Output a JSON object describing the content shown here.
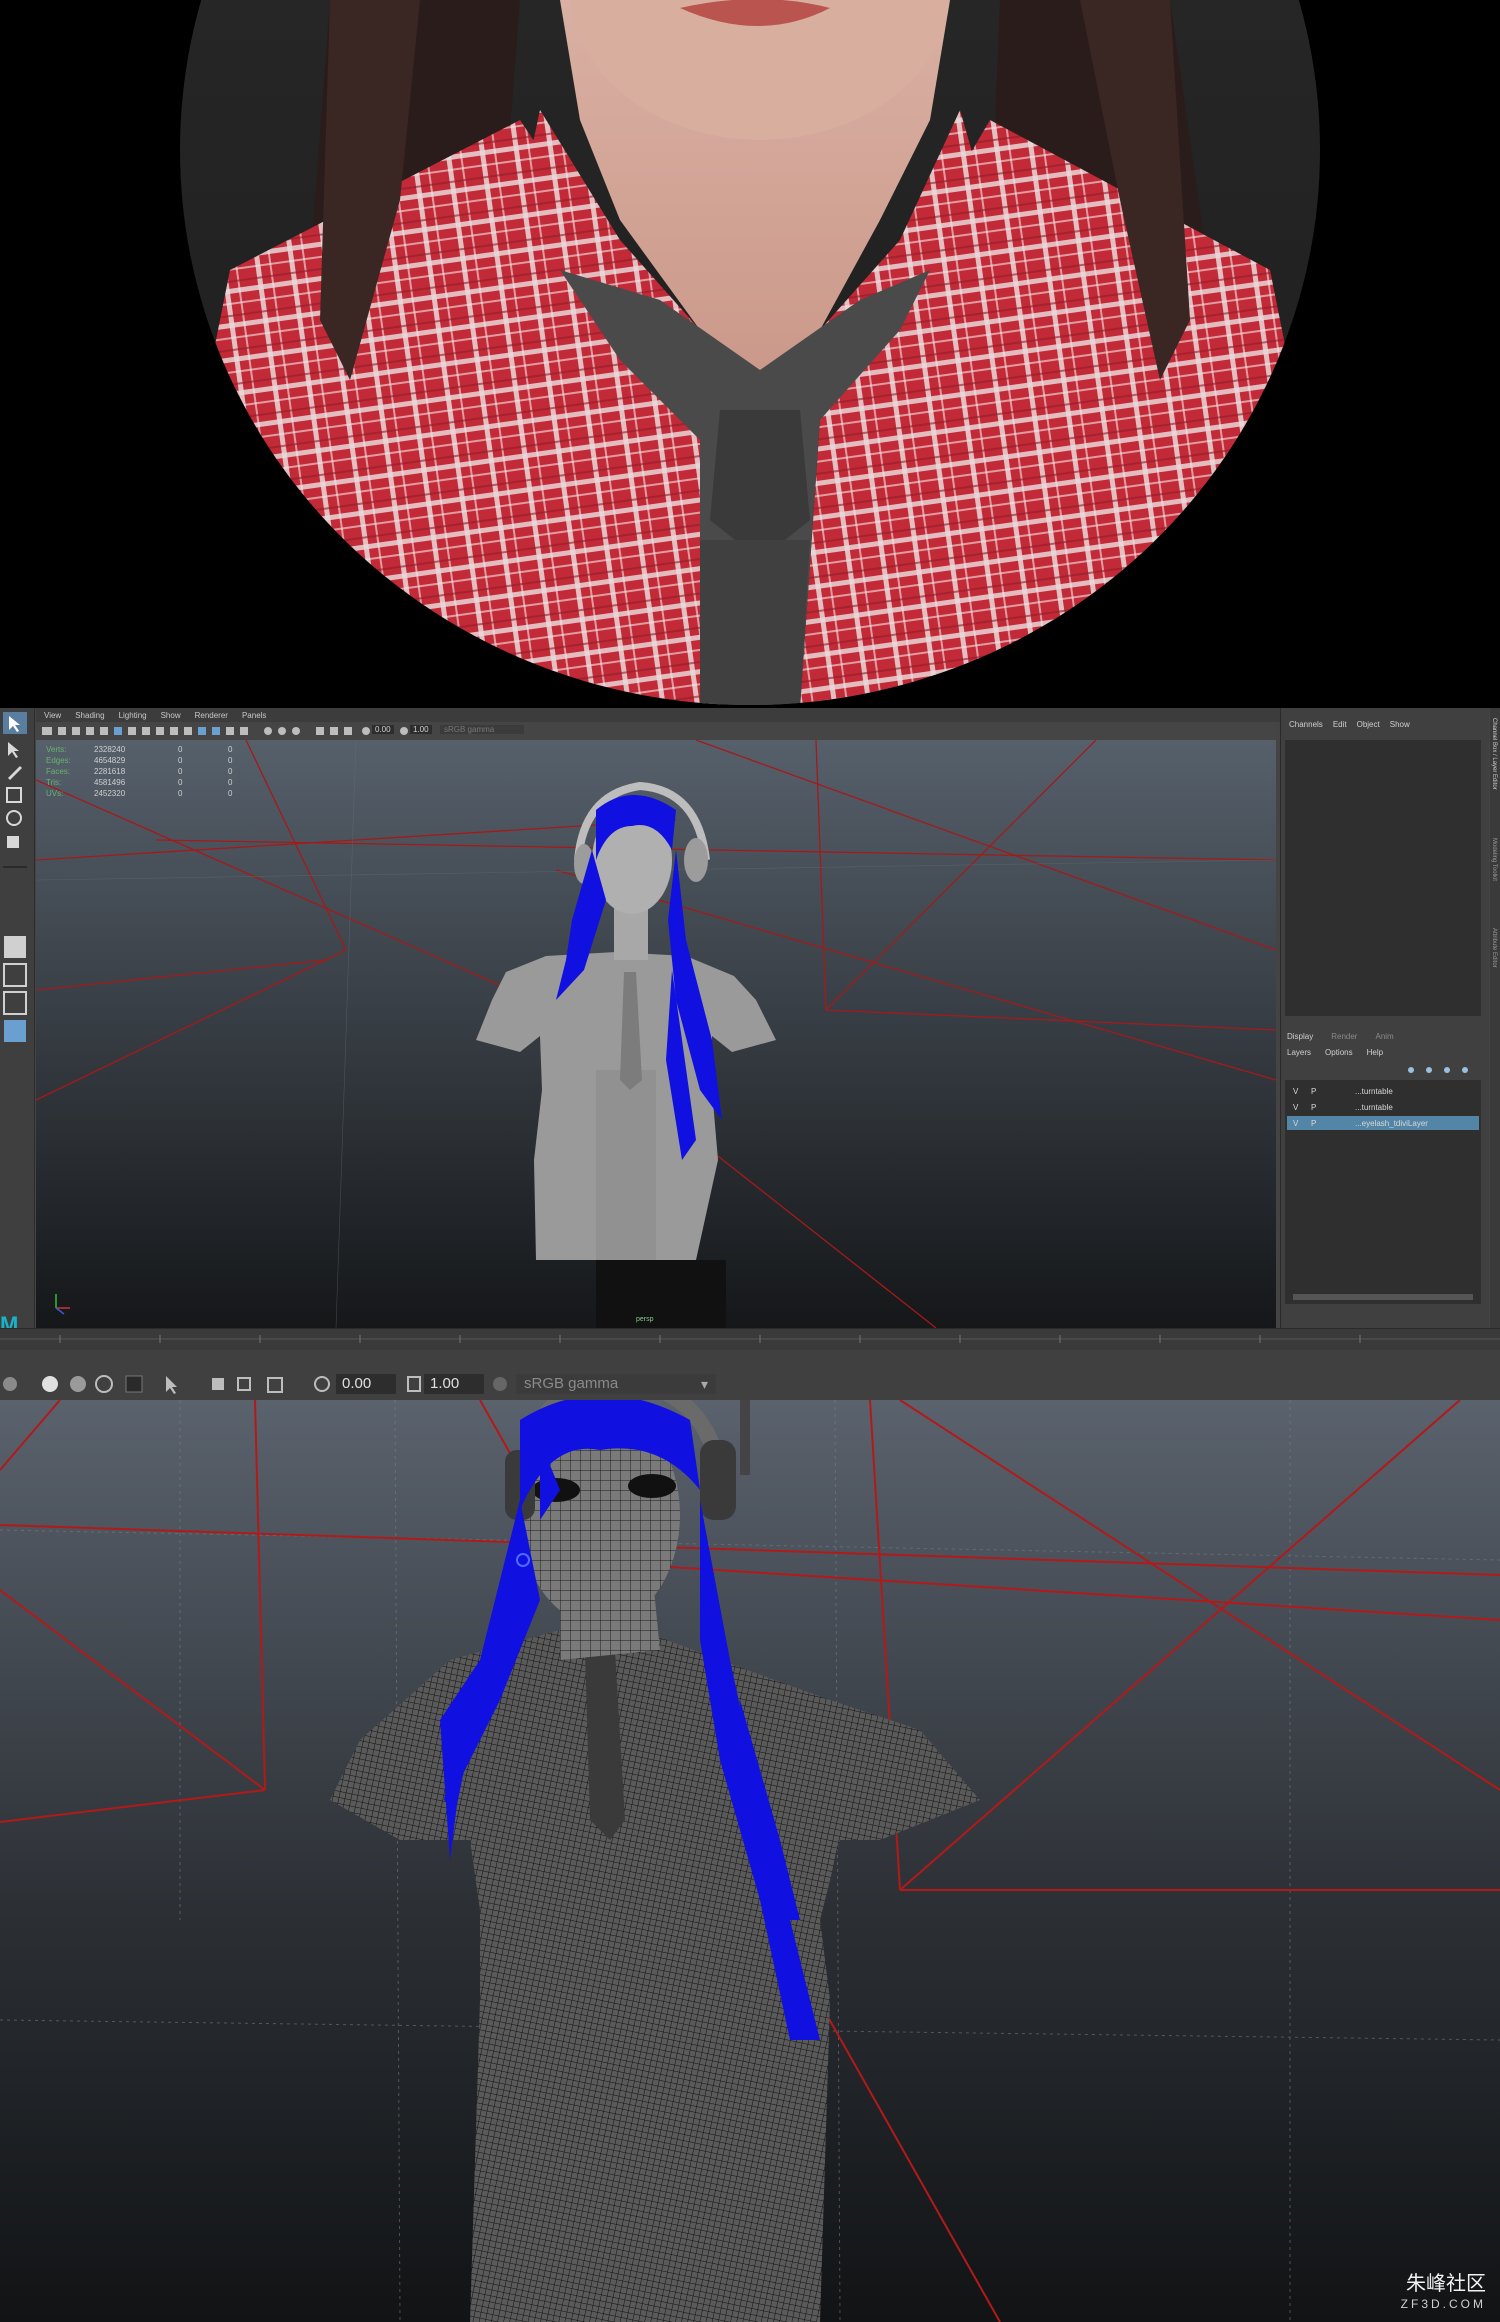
{
  "maya": {
    "menu": [
      "View",
      "Shading",
      "Lighting",
      "Show",
      "Renderer",
      "Panels"
    ],
    "toolbar_exposure": "0.00",
    "toolbar_gamma": "1.00",
    "toolbar_colorspace": "sRGB gamma",
    "hud_rows": [
      {
        "key": "Verts:",
        "v1": "2328240",
        "v2": "0",
        "v3": "0"
      },
      {
        "key": "Edges:",
        "v1": "4654829",
        "v2": "0",
        "v3": "0"
      },
      {
        "key": "Faces:",
        "v1": "2281618",
        "v2": "0",
        "v3": "0"
      },
      {
        "key": "Tris:",
        "v1": "4581496",
        "v2": "0",
        "v3": "0"
      },
      {
        "key": "UVs:",
        "v1": "2452320",
        "v2": "0",
        "v3": "0"
      }
    ],
    "camera_label": "persp",
    "channel_box_menu": [
      "Channels",
      "Edit",
      "Object",
      "Show"
    ],
    "display_tabs": [
      "Display",
      "Render",
      "Anim"
    ],
    "display_menu": [
      "Layers",
      "Options",
      "Help"
    ],
    "layers": [
      {
        "v": "V",
        "p": "P",
        "name": "...turntable",
        "selected": false
      },
      {
        "v": "V",
        "p": "P",
        "name": "...turntable",
        "selected": false
      },
      {
        "v": "V",
        "p": "P",
        "name": "...eyelash_tdiviLayer",
        "selected": true
      }
    ],
    "side_tabs": [
      "Channel Box / Layer Editor",
      "Modeling Toolkit",
      "Attribute Editor"
    ]
  },
  "viewport2": {
    "exposure": "0.00",
    "gamma": "1.00",
    "colorspace": "sRGB gamma"
  },
  "watermark": {
    "cn": "朱峰社区",
    "url": "ZF3D.COM"
  },
  "colors": {
    "hair_blue": "#1010e0",
    "grid_red": "#b01818",
    "shirt_red": "#c8283a",
    "maya_select": "#5285a6"
  }
}
